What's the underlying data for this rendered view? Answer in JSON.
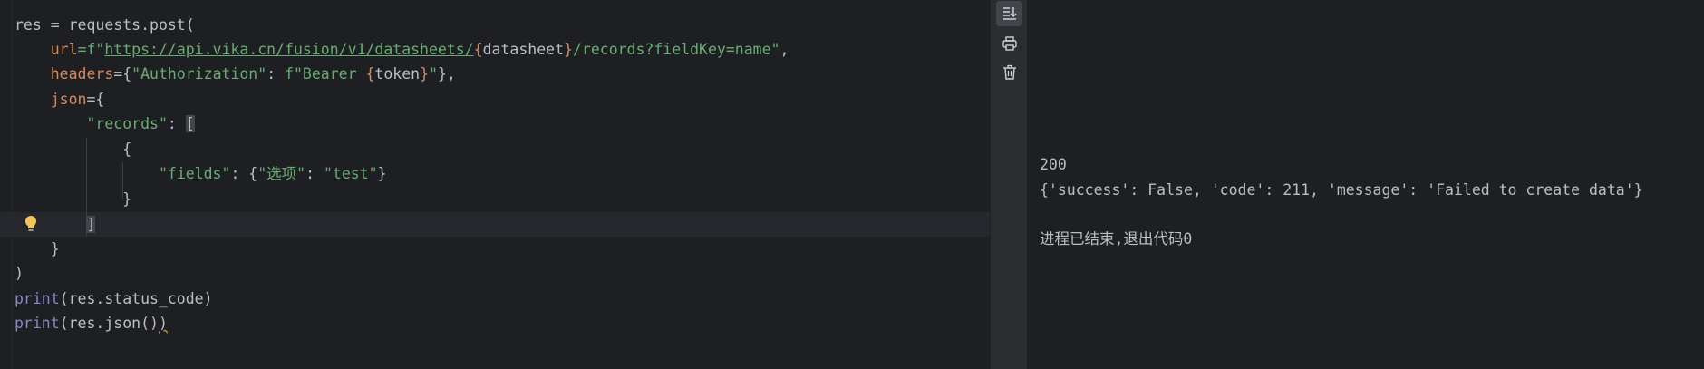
{
  "editor": {
    "lines": {
      "l1": "res = requests.post(",
      "l2_param": "url",
      "l2_eq": "=f\"",
      "l2_link": "https://api.vika.cn/fusion/v1/datasheets/",
      "l2_brace_open": "{",
      "l2_var": "datasheet",
      "l2_brace_close": "}",
      "l2_rest": "/records?fieldKey=name\"",
      "l2_end": ",",
      "l3_param": "headers",
      "l3_a": "={",
      "l3_key": "\"Authorization\"",
      "l3_colon": ": ",
      "l3_fstr": "f\"Bearer ",
      "l3_brace_open": "{",
      "l3_var": "token",
      "l3_brace_close": "}",
      "l3_quote": "\"",
      "l3_end": "},",
      "l4_param": "json",
      "l4_a": "={",
      "l5_key": "\"records\"",
      "l5_colon": ": ",
      "l5_bracket": "[",
      "l6": "{",
      "l7_key": "\"fields\"",
      "l7_colon": ": {",
      "l7_k2": "\"选项\"",
      "l7_colon2": ": ",
      "l7_val": "\"test\"",
      "l7_end": "}",
      "l8": "}",
      "l9_bracket": "]",
      "l10": "}",
      "l11": ")",
      "l12_fn": "print",
      "l12_rest": "(res.status_code)",
      "l13_fn": "print",
      "l13_rest": "(res.json()",
      "l13_paren": ")"
    }
  },
  "sidebar": {
    "icons": [
      "scroll-to-end-icon",
      "print-icon",
      "trash-icon"
    ]
  },
  "console": {
    "status": "200",
    "response": "{'success': False, 'code': 211, 'message': 'Failed to create data'}",
    "exit_message": "进程已结束,退出代码0"
  },
  "colors": {
    "background": "#1e1f22",
    "string": "#6aab73",
    "param": "#d78a5a",
    "builtin": "#8888c6",
    "text": "#bcbec4"
  }
}
